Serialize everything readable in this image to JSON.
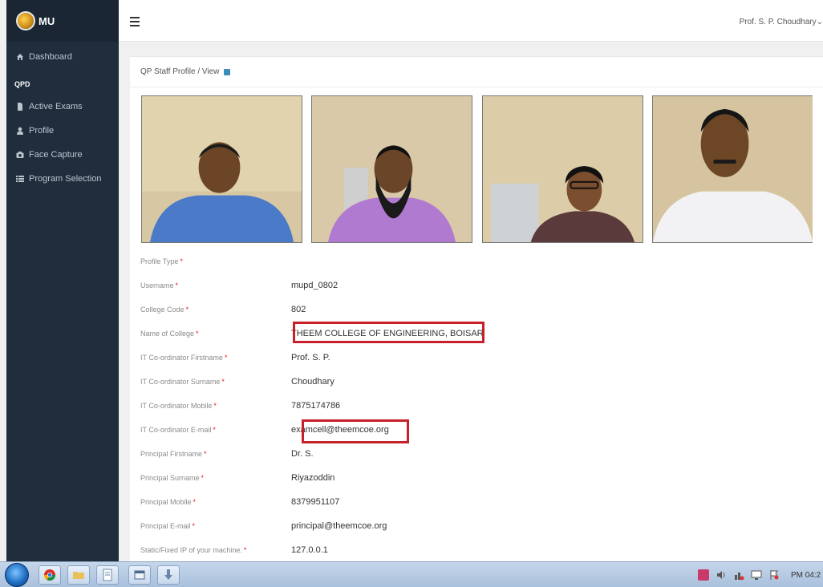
{
  "brand": {
    "name": "MU"
  },
  "sidebar": {
    "dashboard": "Dashboard",
    "section": "QPD",
    "items": [
      "Active Exams",
      "Profile",
      "Face Capture",
      "Program Selection"
    ]
  },
  "topbar": {
    "user": "Prof. S. P. Choudhary"
  },
  "breadcrumb": "QP Staff Profile / View",
  "profile": {
    "fields": [
      {
        "label": "Profile Type",
        "value": ""
      },
      {
        "label": "Username",
        "value": "mupd_0802"
      },
      {
        "label": "College Code",
        "value": "802"
      },
      {
        "label": "Name of College",
        "value": "THEEM COLLEGE OF ENGINEERING, BOISAR"
      },
      {
        "label": "IT Co-ordinator Firstname",
        "value": "Prof. S. P."
      },
      {
        "label": "IT Co-ordinator Surname",
        "value": "Choudhary"
      },
      {
        "label": "IT Co-ordinator Mobile",
        "value": "7875174786"
      },
      {
        "label": "IT Co-ordinator E-mail",
        "value": "examcell@theemcoe.org"
      },
      {
        "label": "Principal Firstname",
        "value": "Dr. S."
      },
      {
        "label": "Principal Surname",
        "value": "Riyazoddin"
      },
      {
        "label": "Principal Mobile",
        "value": "8379951107"
      },
      {
        "label": "Principal E-mail",
        "value": "principal@theemcoe.org"
      },
      {
        "label": "Static/Fixed IP of your machine.",
        "value": "127.0.0.1"
      }
    ],
    "required_mark": "*"
  },
  "taskbar": {
    "clock": "PM 04:2"
  },
  "colors": {
    "sidebar": "#1f2d3d",
    "accent": "#3c8dbc",
    "highlight": "#c8202a"
  }
}
